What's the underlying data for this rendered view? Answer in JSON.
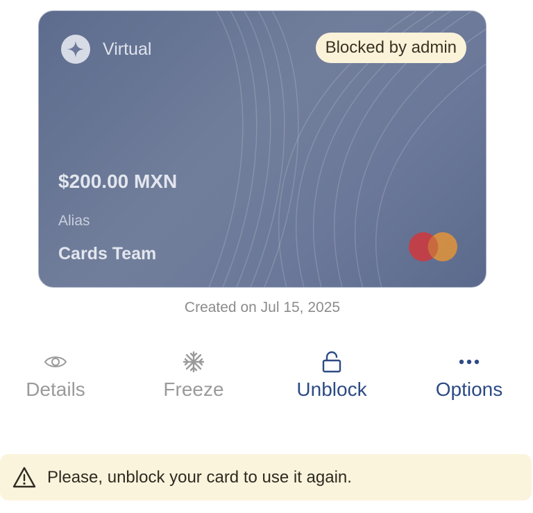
{
  "card": {
    "type_label": "Virtual",
    "status": "Blocked by admin",
    "balance": "$200.00 MXN",
    "alias_label": "Alias",
    "alias_value": "Cards Team",
    "created": "Created on Jul 15, 2025",
    "colors": {
      "card_bg": "#6b7899",
      "badge_bg": "#fbf3d9",
      "mc_red": "#c0404a",
      "mc_orange": "#d99040"
    },
    "icons": {
      "type": "sparkle-icon",
      "network": "mastercard-logo"
    }
  },
  "actions": [
    {
      "label": "Details",
      "icon": "eye-icon",
      "state": "disabled"
    },
    {
      "label": "Freeze",
      "icon": "snowflake-icon",
      "state": "disabled"
    },
    {
      "label": "Unblock",
      "icon": "unlock-icon",
      "state": "active"
    },
    {
      "label": "Options",
      "icon": "more-dots-icon",
      "state": "active"
    }
  ],
  "colors": {
    "accent": "#2c4a84",
    "disabled": "#9a9a9a",
    "banner_bg": "#fbf4dd"
  },
  "banner": {
    "icon": "warning-icon",
    "message": "Please, unblock your card to use it again."
  }
}
